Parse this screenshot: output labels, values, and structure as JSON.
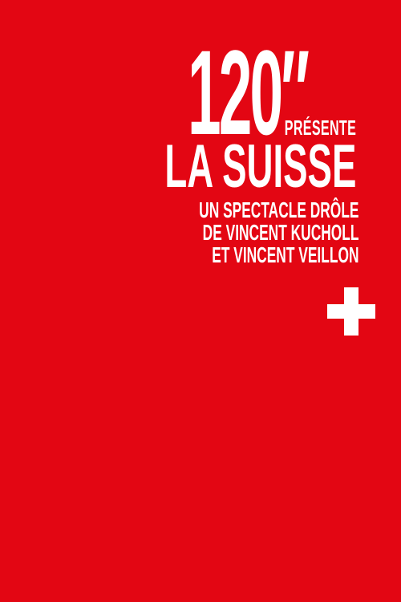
{
  "poster": {
    "background_color": "#e30613",
    "text_color": "#ffffff",
    "title_number": "120″",
    "presente": "PRÉSENTE",
    "main_title": "LA SUISSE",
    "subtitle_lines": [
      "UN SPECTACLE DRÔLE",
      "DE VINCENT KUCHOLL",
      "ET VINCENT VEILLON"
    ],
    "emblem": "swiss-cross-icon"
  }
}
